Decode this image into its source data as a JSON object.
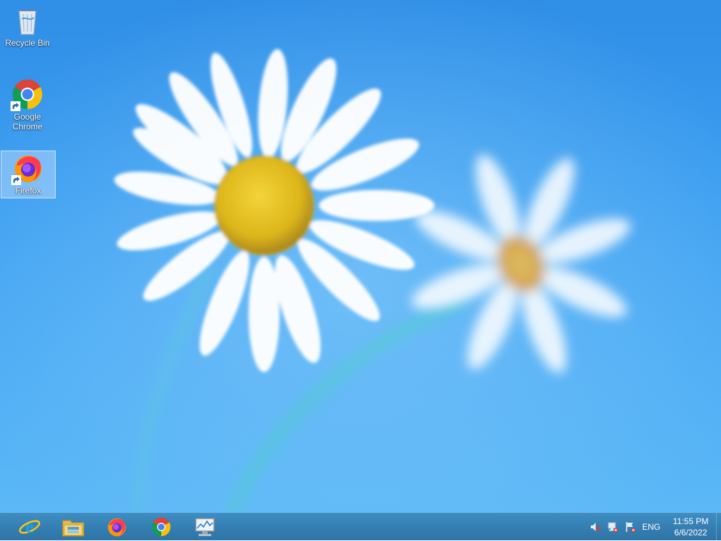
{
  "desktop": {
    "icons": [
      {
        "label": "Recycle Bin",
        "icon": "recycle-bin-icon",
        "shortcut": false,
        "selected": false
      },
      {
        "label": "Google Chrome",
        "icon": "chrome-icon",
        "shortcut": true,
        "selected": false
      },
      {
        "label": "Firefox",
        "icon": "firefox-icon",
        "shortcut": true,
        "selected": true
      }
    ]
  },
  "taskbar": {
    "pinned": [
      {
        "name": "Internet Explorer",
        "icon": "internet-explorer-icon"
      },
      {
        "name": "File Explorer",
        "icon": "file-explorer-icon"
      },
      {
        "name": "Firefox",
        "icon": "firefox-icon"
      },
      {
        "name": "Google Chrome",
        "icon": "chrome-icon"
      },
      {
        "name": "Performance Monitor",
        "icon": "monitor-icon"
      }
    ],
    "tray": {
      "icons": [
        "volume-muted-icon",
        "network-disconnected-icon",
        "action-center-flag-icon"
      ],
      "language": "ENG",
      "time": "11:55 PM",
      "date": "6/6/2022"
    }
  },
  "colors": {
    "desktop_blue": "#3b9df0",
    "taskbar": "#357fb3",
    "flower_center": "#e8c21c",
    "error_red": "#e53935"
  }
}
